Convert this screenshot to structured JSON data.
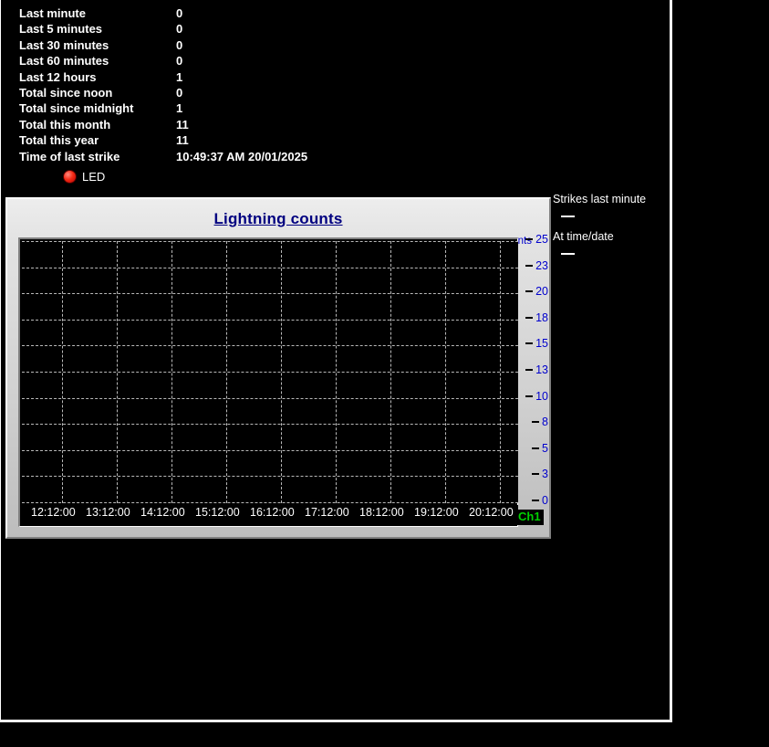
{
  "window": {
    "title": "Lightning counts"
  },
  "stats": {
    "rows": [
      {
        "label": "Last minute",
        "value": "0"
      },
      {
        "label": "Last 5 minutes",
        "value": "0"
      },
      {
        "label": "Last 30 minutes",
        "value": "0"
      },
      {
        "label": "Last 60 minutes",
        "value": "0"
      },
      {
        "label": "Last 12 hours",
        "value": "1"
      },
      {
        "label": "Total since noon",
        "value": "0"
      },
      {
        "label": "Total since midnight",
        "value": "1"
      },
      {
        "label": "Total this month",
        "value": "11"
      },
      {
        "label": "Total this year",
        "value": "11"
      },
      {
        "label": "Time of last strike",
        "value": "10:49:37 AM 20/01/2025"
      }
    ]
  },
  "led": {
    "label": "LED",
    "icon": "led-indicator-icon",
    "color": "#f52b16",
    "state": "off"
  },
  "readouts": [
    {
      "label": "Strikes last minute",
      "value": ""
    },
    {
      "label": "At time/date",
      "value": ""
    }
  ],
  "chart_panel": {
    "title": "Lightning counts",
    "title_color": "#000080",
    "channel_badge": "Ch1",
    "channel_badge_color": "#00d000"
  },
  "chart_data": {
    "type": "line",
    "title": "Lightning counts",
    "xlabel": "",
    "ylabel": "counts",
    "ylim": [
      0,
      25
    ],
    "grid": true,
    "legend_position": "right",
    "plot_background": "#000000",
    "gridline_color": "#b8b8b8",
    "axis_label_color": "#0000cd",
    "ytick_labels": [
      "25",
      "23",
      "20",
      "18",
      "15",
      "13",
      "10",
      "8",
      "5",
      "3",
      "0"
    ],
    "ytick_values": [
      25,
      23,
      20,
      18,
      15,
      13,
      10,
      8,
      5,
      3,
      0
    ],
    "xtick_labels": [
      "12:12:00",
      "13:12:00",
      "14:12:00",
      "15:12:00",
      "16:12:00",
      "17:12:00",
      "18:12:00",
      "19:12:00",
      "20:12:00"
    ],
    "series": [
      {
        "name": "Ch1",
        "color": "#00d000",
        "values": []
      }
    ],
    "note": "No data plotted; plot area is empty"
  }
}
